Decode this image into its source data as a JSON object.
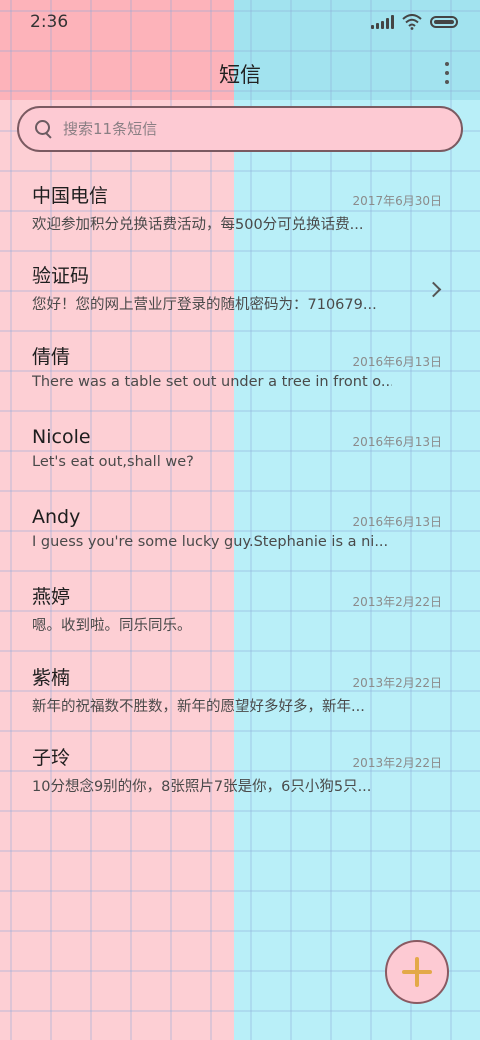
{
  "status_bar": {
    "time": "2:36"
  },
  "header": {
    "title": "短信"
  },
  "search": {
    "placeholder": "搜索11条短信"
  },
  "colors": {
    "left_panel": "#fdcfd4",
    "right_panel": "#b9eff8",
    "plus_accent": "#e3a948"
  },
  "messages": [
    {
      "name": "中国电信",
      "date": "2017年6月30日",
      "preview": "欢迎参加积分兑换话费活动，每500分可兑换话费..."
    },
    {
      "name": "验证码",
      "date": "",
      "preview": "您好！您的网上营业厅登录的随机密码为：710679..."
    },
    {
      "name": "倩倩",
      "date": "2016年6月13日",
      "preview": "There was a table set out under a tree in front o..."
    },
    {
      "name": "Nicole",
      "date": "2016年6月13日",
      "preview": "Let's eat out,shall we?"
    },
    {
      "name": "Andy",
      "date": "2016年6月13日",
      "preview": "I guess you're some lucky guy.Stephanie is a ni..."
    },
    {
      "name": "燕婷",
      "date": "2013年2月22日",
      "preview": "嗯。收到啦。同乐同乐。"
    },
    {
      "name": "紫楠",
      "date": "2013年2月22日",
      "preview": "新年的祝福数不胜数，新年的愿望好多好多，新年..."
    },
    {
      "name": "子玲",
      "date": "2013年2月22日",
      "preview": "10分想念9别的你，8张照片7张是你，6只小狗5只..."
    }
  ],
  "icons": {
    "search": "search-icon",
    "menu": "more-vertical-icon",
    "chevron": "chevron-right-icon",
    "compose": "plus-icon"
  }
}
